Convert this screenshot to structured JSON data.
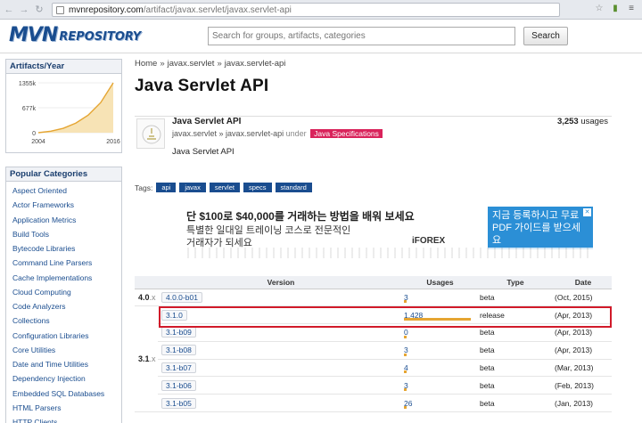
{
  "browser": {
    "url_host": "mvnrepository.com",
    "url_path": "/artifact/javax.servlet/javax.servlet-api"
  },
  "header": {
    "logo_mvn": "MVN",
    "logo_repository": "REPOSITORY",
    "search_placeholder": "Search for groups, artifacts, categories",
    "search_button": "Search"
  },
  "sidebar": {
    "artifacts_title": "Artifacts/Year",
    "chart_data": {
      "type": "area",
      "title": "Artifacts/Year",
      "x": [
        2004,
        2006,
        2008,
        2010,
        2012,
        2014,
        2016
      ],
      "values": [
        0,
        40,
        120,
        260,
        480,
        820,
        1355
      ],
      "ytick_labels": [
        "1355k",
        "677k",
        "0"
      ],
      "xtick_labels": [
        "2004",
        "2016"
      ],
      "ylim": [
        0,
        1355
      ],
      "color": "#e5a532"
    },
    "categories_title": "Popular Categories",
    "categories": [
      "Aspect Oriented",
      "Actor Frameworks",
      "Application Metrics",
      "Build Tools",
      "Bytecode Libraries",
      "Command Line Parsers",
      "Cache Implementations",
      "Cloud Computing",
      "Code Analyzers",
      "Collections",
      "Configuration Libraries",
      "Core Utilities",
      "Date and Time Utilities",
      "Dependency Injection",
      "Embedded SQL Databases",
      "HTML Parsers",
      "HTTP Clients"
    ]
  },
  "main": {
    "breadcrumb": [
      "Home",
      "javax.servlet",
      "javax.servlet-api"
    ],
    "title": "Java Servlet API",
    "artifact": {
      "name": "Java Servlet API",
      "group": "javax.servlet",
      "artifact_id": "javax.servlet-api",
      "under": "under",
      "category": "Java Specifications",
      "description": "Java Servlet API",
      "usages_count": "3,253",
      "usages_label": "usages"
    },
    "tags_label": "Tags:",
    "tags": [
      "api",
      "javax",
      "servlet",
      "specs",
      "standard"
    ],
    "ad": {
      "line1": "단 $100로 $40,000를 거래하는 방법을 배워 보세요",
      "line2": "특별한 일대일 트레이닝 코스로 전문적인",
      "line3": "거래자가 되세요",
      "brand": "iFOREX",
      "cta": "지금 등록하시고 무료 PDF 가이드를 받으세요"
    },
    "table": {
      "headers": [
        "Version",
        "Usages",
        "Type",
        "Date"
      ],
      "groups": [
        {
          "label": "4.0",
          "suffix": ".x"
        },
        {
          "label": "3.1",
          "suffix": ".x"
        }
      ],
      "rows": [
        {
          "group": 0,
          "version": "4.0.0-b01",
          "usages": "3",
          "usage_fraction": 0.01,
          "type": "beta",
          "date": "(Oct, 2015)"
        },
        {
          "group": 1,
          "version": "3.1.0",
          "usages": "1,428",
          "usage_fraction": 1.0,
          "type": "release",
          "date": "(Apr, 2013)"
        },
        {
          "group": 1,
          "version": "3.1-b09",
          "usages": "0",
          "usage_fraction": 0.0,
          "type": "beta",
          "date": "(Apr, 2013)"
        },
        {
          "group": 1,
          "version": "3.1-b08",
          "usages": "3",
          "usage_fraction": 0.01,
          "type": "beta",
          "date": "(Apr, 2013)"
        },
        {
          "group": 1,
          "version": "3.1-b07",
          "usages": "4",
          "usage_fraction": 0.01,
          "type": "beta",
          "date": "(Mar, 2013)"
        },
        {
          "group": 1,
          "version": "3.1-b06",
          "usages": "3",
          "usage_fraction": 0.01,
          "type": "beta",
          "date": "(Feb, 2013)"
        },
        {
          "group": 1,
          "version": "3.1-b05",
          "usages": "26",
          "usage_fraction": 0.03,
          "type": "beta",
          "date": "(Jan, 2013)"
        }
      ]
    }
  }
}
